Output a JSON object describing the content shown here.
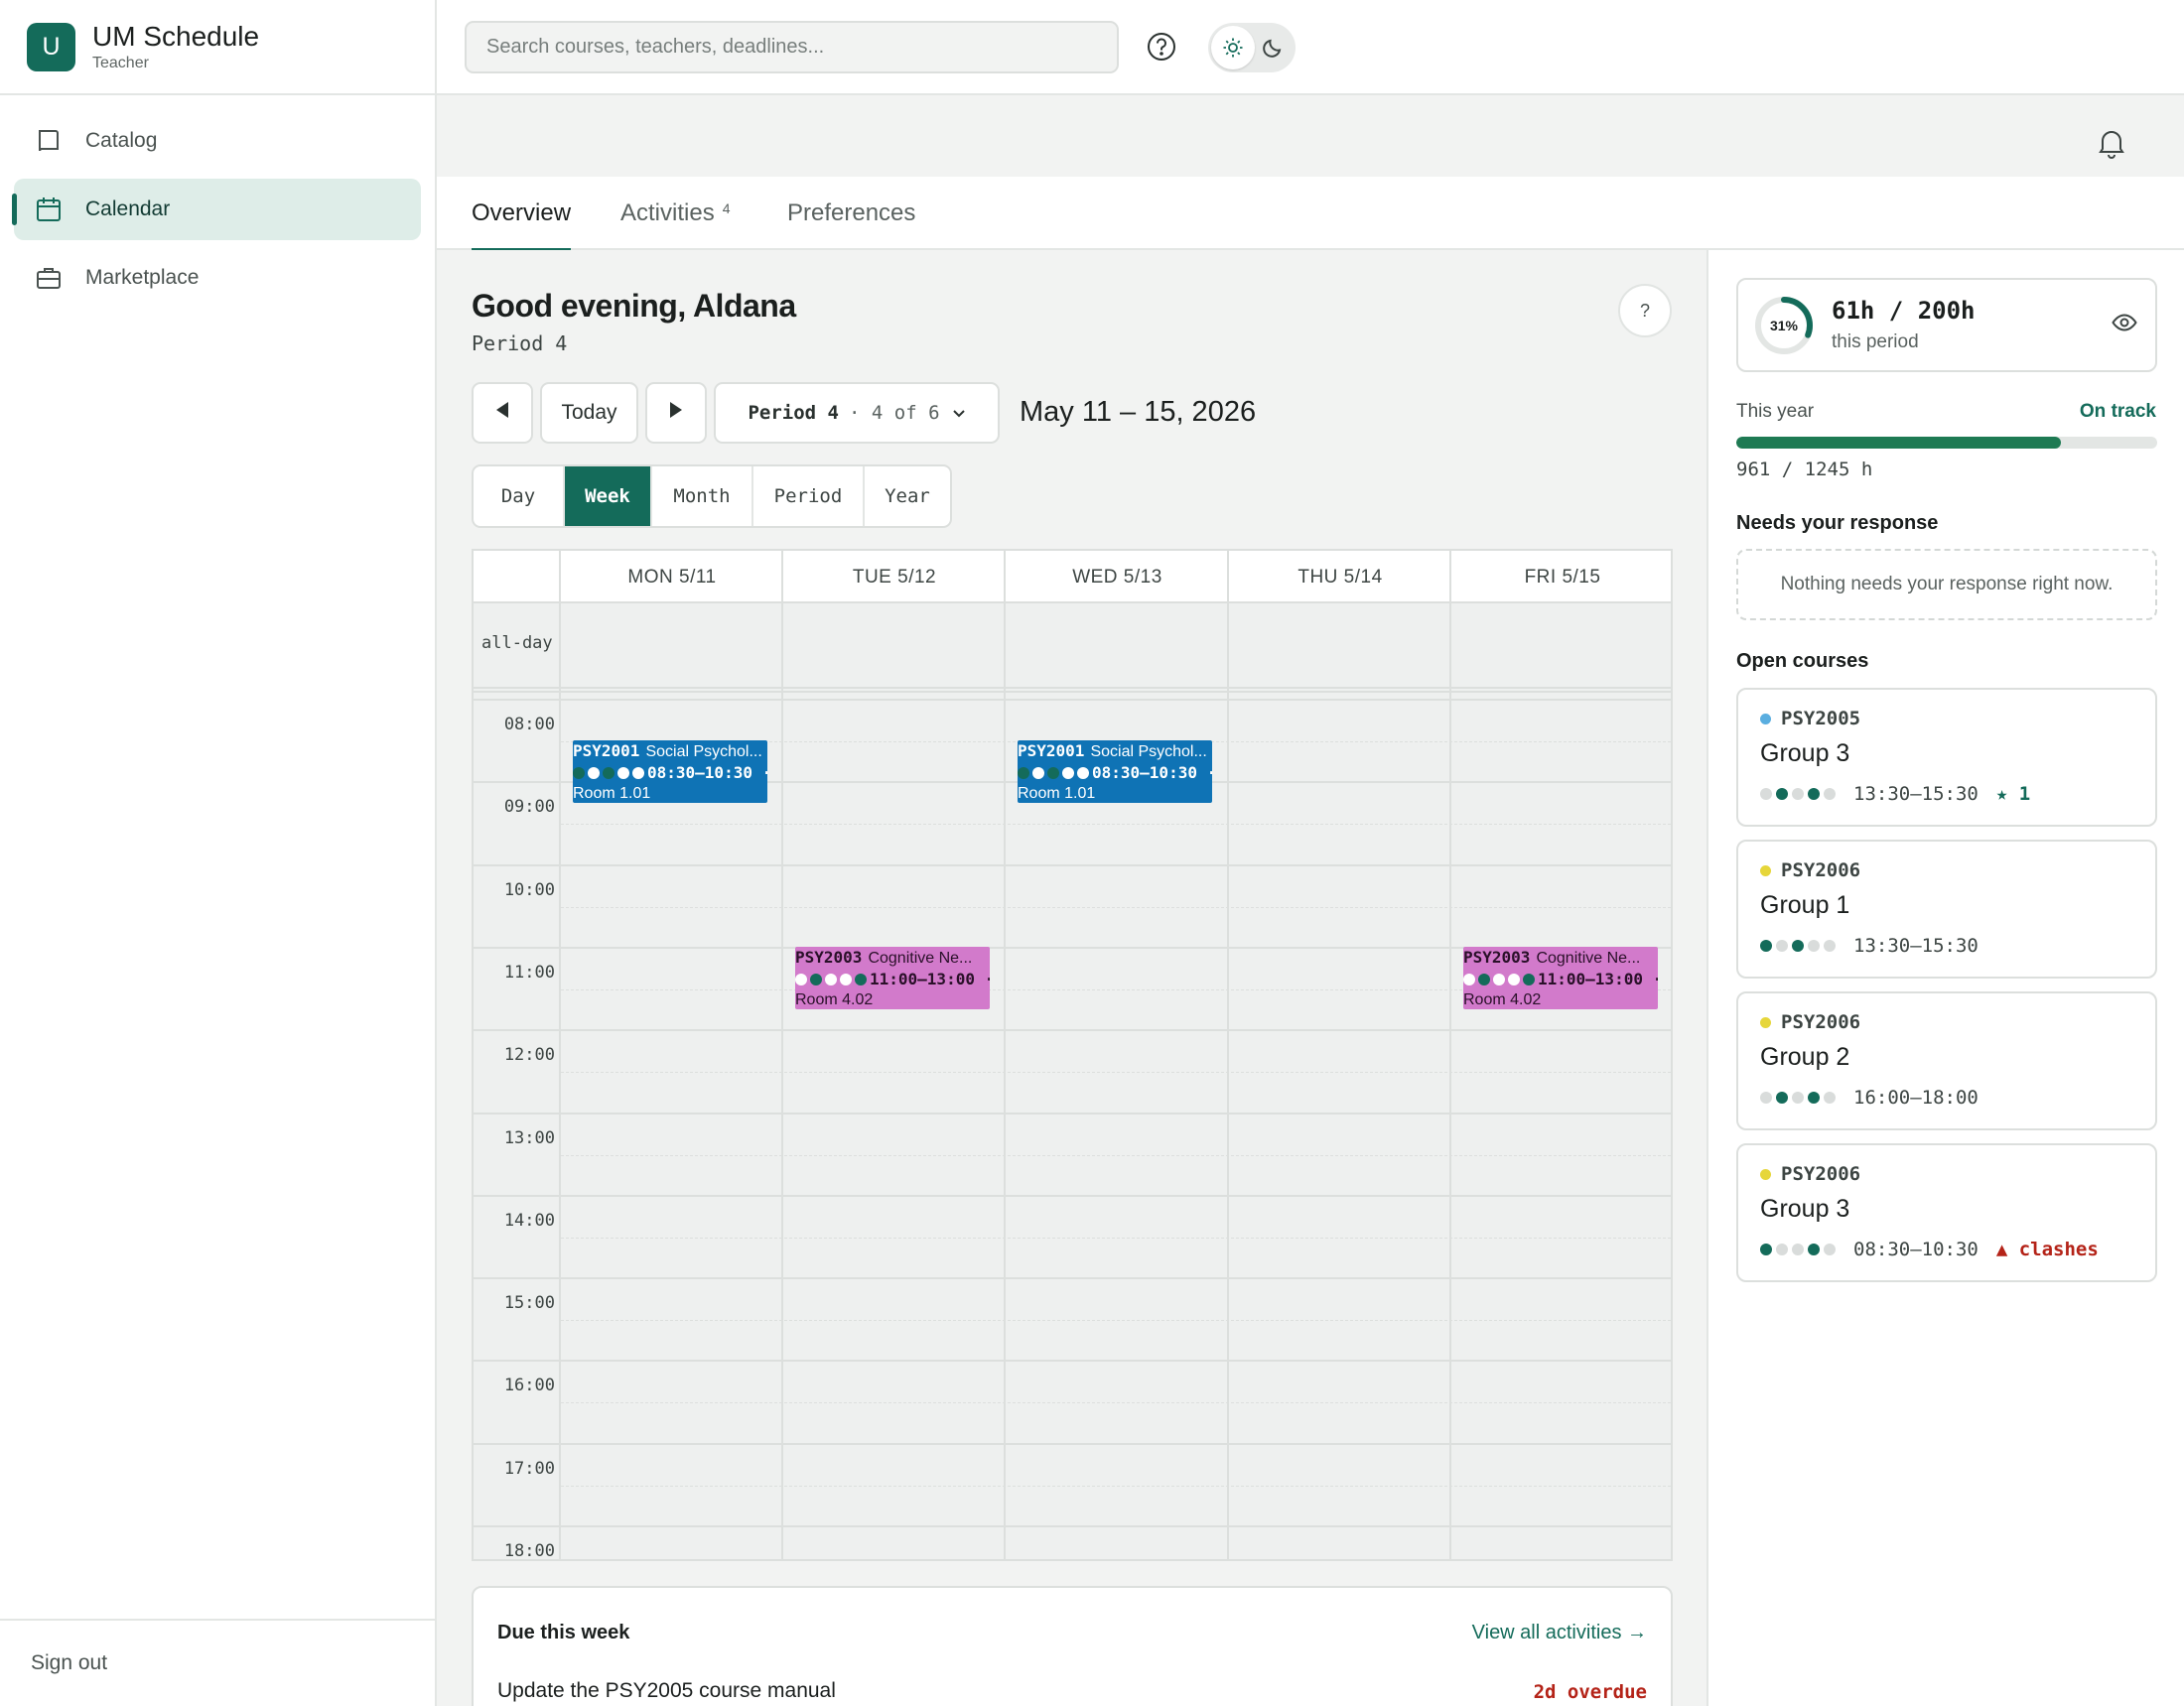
{
  "app": {
    "logo_letter": "U",
    "title": "UM Schedule",
    "role": "Teacher"
  },
  "sidebar": {
    "items": [
      {
        "label": "Catalog",
        "icon": "book-icon",
        "active": false
      },
      {
        "label": "Calendar",
        "icon": "calendar-icon",
        "active": true
      },
      {
        "label": "Marketplace",
        "icon": "briefcase-icon",
        "active": false
      }
    ],
    "sign_out": "Sign out"
  },
  "topbar": {
    "search_placeholder": "Search courses, teachers, deadlines..."
  },
  "tabs": [
    {
      "label": "Overview",
      "active": true
    },
    {
      "label": "Activities",
      "badge": "4"
    },
    {
      "label": "Preferences"
    }
  ],
  "main": {
    "greeting": "Good evening, Aldana",
    "period": "Period 4",
    "help": "?",
    "today": "Today",
    "period_select_main": "Period 4",
    "period_select_sub": "· 4 of 6",
    "date_range": "May 11 – 15, 2026",
    "views": [
      "Day",
      "Week",
      "Month",
      "Period",
      "Year"
    ],
    "active_view": "Week"
  },
  "calendar": {
    "allday_label": "all-day",
    "days": [
      "MON 5/11",
      "TUE 5/12",
      "WED 5/13",
      "THU 5/14",
      "FRI 5/15"
    ],
    "hours": [
      "08:00",
      "09:00",
      "10:00",
      "11:00",
      "12:00",
      "13:00",
      "14:00",
      "15:00",
      "16:00",
      "17:00",
      "18:00"
    ],
    "events": [
      {
        "day": 0,
        "code": "PSY2001",
        "title": "Social Psychol...",
        "time": "08:30–10:30 ·",
        "room": "Room 1.01",
        "color": "blue",
        "dots": [
          "#146b5a",
          "#ffffff",
          "#146b5a",
          "#ffffff",
          "#ffffff"
        ]
      },
      {
        "day": 2,
        "code": "PSY2001",
        "title": "Social Psychol...",
        "time": "08:30–10:30 ·",
        "room": "Room 1.01",
        "color": "blue",
        "dots": [
          "#146b5a",
          "#ffffff",
          "#146b5a",
          "#ffffff",
          "#ffffff"
        ]
      },
      {
        "day": 1,
        "code": "PSY2003",
        "title": "Cognitive Ne...",
        "time": "11:00–13:00 ·",
        "room": "Room 4.02",
        "color": "pink",
        "dots": [
          "#ffffff",
          "#146b5a",
          "#ffffff",
          "#ffffff",
          "#146b5a"
        ]
      },
      {
        "day": 4,
        "code": "PSY2003",
        "title": "Cognitive Ne...",
        "time": "11:00–13:00 ·",
        "room": "Room 4.02",
        "color": "pink",
        "dots": [
          "#ffffff",
          "#146b5a",
          "#ffffff",
          "#ffffff",
          "#146b5a"
        ]
      }
    ]
  },
  "due": {
    "title": "Due this week",
    "link": "View all activities →",
    "item": "Update the PSY2005 course manual",
    "status": "2d overdue"
  },
  "right": {
    "percent": "31%",
    "percent_value": 0.31,
    "hours": "61h / 200h",
    "hours_sub": "this period",
    "year_label": "This year",
    "year_status": "On track",
    "year_value": "961 / 1245 h",
    "year_fraction": 0.772,
    "needs_title": "Needs your response",
    "nothing": "Nothing needs your response right now.",
    "open_title": "Open courses",
    "courses": [
      {
        "code": "PSY2005",
        "dot": "#5aaee0",
        "group": "Group 3",
        "time": "13:30–15:30",
        "extra": "★ 1",
        "extra_color": "#146b5a",
        "dots": [
          "#d9dcdb",
          "#146b5a",
          "#d9dcdb",
          "#146b5a",
          "#d9dcdb"
        ]
      },
      {
        "code": "PSY2006",
        "dot": "#e6d63a",
        "group": "Group 1",
        "time": "13:30–15:30",
        "extra": "",
        "extra_color": "#146b5a",
        "dots": [
          "#146b5a",
          "#d9dcdb",
          "#146b5a",
          "#d9dcdb",
          "#d9dcdb"
        ]
      },
      {
        "code": "PSY2006",
        "dot": "#e6d63a",
        "group": "Group 2",
        "time": "16:00–18:00",
        "extra": "",
        "extra_color": "#146b5a",
        "dots": [
          "#d9dcdb",
          "#146b5a",
          "#d9dcdb",
          "#146b5a",
          "#d9dcdb"
        ]
      },
      {
        "code": "PSY2006",
        "dot": "#e6d63a",
        "group": "Group 3",
        "time": "08:30–10:30",
        "extra": "▲ clashes",
        "extra_color": "#b42318",
        "dots": [
          "#146b5a",
          "#d9dcdb",
          "#d9dcdb",
          "#146b5a",
          "#d9dcdb"
        ]
      }
    ]
  }
}
